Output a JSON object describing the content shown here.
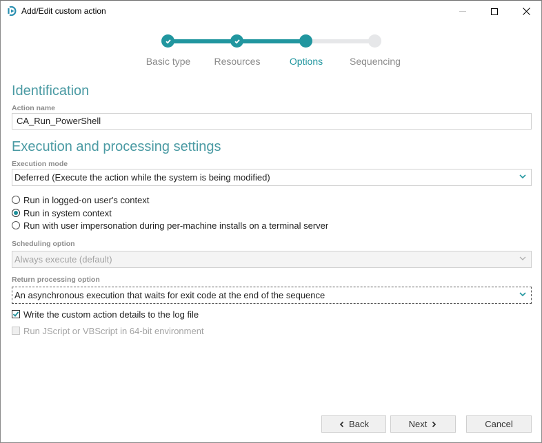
{
  "window": {
    "title": "Add/Edit custom action",
    "icon": "app-logo-icon",
    "controls": {
      "minimize": "minimize-icon",
      "maximize": "maximize-icon",
      "close": "close-icon"
    }
  },
  "wizard": {
    "steps": [
      {
        "label": "Basic type",
        "state": "done"
      },
      {
        "label": "Resources",
        "state": "done"
      },
      {
        "label": "Options",
        "state": "active"
      },
      {
        "label": "Sequencing",
        "state": "todo"
      }
    ]
  },
  "identification": {
    "title": "Identification",
    "action_name_label": "Action name",
    "action_name_value": "CA_Run_PowerShell"
  },
  "execution": {
    "title": "Execution and processing settings",
    "execution_mode_label": "Execution mode",
    "execution_mode_value": "Deferred (Execute the action while the system is being modified)",
    "context_options": [
      {
        "label": "Run in logged-on user's context",
        "checked": false
      },
      {
        "label": "Run in system context",
        "checked": true
      },
      {
        "label": "Run with user impersonation during per-machine installs on a terminal server",
        "checked": false
      }
    ],
    "scheduling_label": "Scheduling option",
    "scheduling_value": "Always execute (default)",
    "return_label": "Return processing option",
    "return_value": "An asynchronous execution that waits for exit code at the end of the sequence",
    "checkboxes": [
      {
        "label": "Write the custom action details to the log file",
        "checked": true,
        "disabled": false
      },
      {
        "label": "Run JScript or VBScript in 64-bit environment",
        "checked": false,
        "disabled": true
      }
    ]
  },
  "buttons": {
    "back": "Back",
    "next": "Next",
    "cancel": "Cancel"
  },
  "colors": {
    "accent": "#21969f",
    "heading": "#4a9aa3",
    "step_inactive": "#e6e7e9"
  }
}
